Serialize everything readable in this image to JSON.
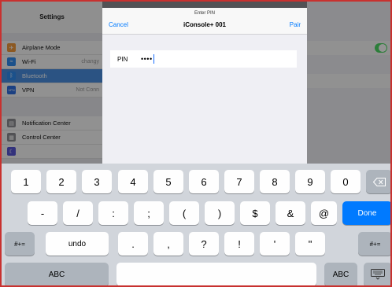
{
  "settings": {
    "title": "Settings",
    "items": [
      {
        "label": "Airplane Mode",
        "icon": "airplane-icon",
        "color": "#f19a3c",
        "sub": ""
      },
      {
        "label": "Wi-Fi",
        "icon": "wifi-icon",
        "color": "#2f8cf0",
        "sub": "changy"
      },
      {
        "label": "Bluetooth",
        "icon": "bluetooth-icon",
        "color": "#2f8cf0",
        "sub": ""
      },
      {
        "label": "VPN",
        "icon": "vpn-icon",
        "color": "#2f6fe0",
        "sub": "Not Conn"
      },
      {
        "label": "Notification Center",
        "icon": "notification-center-icon",
        "color": "#8e8e93",
        "sub": ""
      },
      {
        "label": "Control Center",
        "icon": "control-center-icon",
        "color": "#8e8e93",
        "sub": ""
      }
    ]
  },
  "dialog": {
    "prompt": "Enter PIN",
    "title": "iConsole+ 001",
    "cancel": "Cancel",
    "pair": "Pair",
    "pin_label": "PIN",
    "pin_value": "••••"
  },
  "keyboard": {
    "row1": [
      "1",
      "2",
      "3",
      "4",
      "5",
      "6",
      "7",
      "8",
      "9",
      "0"
    ],
    "row2": [
      "-",
      "/",
      ":",
      ";",
      "(",
      ")",
      "$",
      "&",
      "@"
    ],
    "done": "Done",
    "symbols_toggle": "#+=",
    "undo": "undo",
    "row3": [
      ".",
      ",",
      "?",
      "!",
      "'",
      "\""
    ],
    "abc": "ABC"
  },
  "colors": {
    "accent": "#007aff",
    "toggle_on": "#4cd964",
    "border": "#c8312f"
  }
}
